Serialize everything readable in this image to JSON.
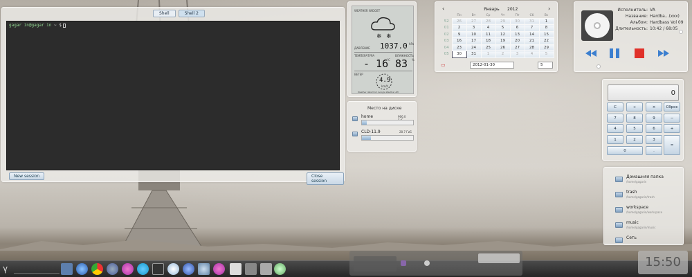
{
  "terminal": {
    "tabs": [
      "Shell",
      "Shell 2"
    ],
    "prompt_user": "gagar in@gagar in",
    "prompt_rest": " ~ $",
    "new_session": "New session",
    "close_session": "Close session"
  },
  "weather": {
    "title": "WEATHER WIDGET",
    "pressure_label": "ДАВЛЕНИЕ",
    "pressure_value": "1037.0",
    "pressure_unit": "hPa",
    "temperature_label": "ТЕМПЕРАТУРА",
    "temperature_value": "- 16",
    "temperature_unit": "°C",
    "humidity_label": "ВЛАЖНОСТЬ",
    "humidity_value": "83",
    "humidity_unit": "%",
    "wind_label": "ВЕТЕР",
    "wind_value": "4.9",
    "wind_unit": "km/h",
    "footer": "Weather data from Google Weather API"
  },
  "disk": {
    "title": "Место на диске",
    "items": [
      {
        "name": "home",
        "size": "966.0 ГиБ",
        "fraction": 0.1
      },
      {
        "name": "CLD-11.9",
        "size": "28.7 ГиБ",
        "fraction": 0.18
      }
    ]
  },
  "calendar": {
    "month": "Январь",
    "year": "2012",
    "prev": "‹",
    "next": "›",
    "weekdays": [
      "Пн",
      "Вт",
      "Ср",
      "Чт",
      "Пт",
      "Сб",
      "Вс"
    ],
    "weeks": [
      {
        "wk": "52",
        "days": [
          "26",
          "27",
          "28",
          "29",
          "30",
          "31",
          "1"
        ],
        "dim": [
          true,
          true,
          true,
          true,
          true,
          true,
          false
        ]
      },
      {
        "wk": "01",
        "days": [
          "2",
          "3",
          "4",
          "5",
          "6",
          "7",
          "8"
        ],
        "dim": [
          false,
          false,
          false,
          false,
          false,
          false,
          false
        ]
      },
      {
        "wk": "02",
        "days": [
          "9",
          "10",
          "11",
          "12",
          "13",
          "14",
          "15"
        ],
        "dim": [
          false,
          false,
          false,
          false,
          false,
          false,
          false
        ]
      },
      {
        "wk": "03",
        "days": [
          "16",
          "17",
          "18",
          "19",
          "20",
          "21",
          "22"
        ],
        "dim": [
          false,
          false,
          false,
          false,
          false,
          false,
          false
        ]
      },
      {
        "wk": "04",
        "days": [
          "23",
          "24",
          "25",
          "26",
          "27",
          "28",
          "29"
        ],
        "dim": [
          false,
          false,
          false,
          false,
          false,
          false,
          false
        ]
      },
      {
        "wk": "05",
        "days": [
          "30",
          "31",
          "1",
          "2",
          "3",
          "4",
          "5"
        ],
        "dim": [
          false,
          false,
          true,
          true,
          true,
          true,
          true
        ]
      }
    ],
    "selected_day": "30",
    "date_value": "2012-01-30",
    "week_value": "5"
  },
  "media": {
    "artist_label": "Исполнитель:",
    "artist": "VA",
    "title_label": "Название:",
    "title": "Hardba...(xxx)",
    "album_label": "Альбом:",
    "album": "Hardbass Vol 09",
    "duration_label": "Длительность:",
    "duration": "10:42 / 68:05",
    "progress": 0.16,
    "volume": 0.9
  },
  "calculator": {
    "display": "0",
    "keys": [
      [
        "C",
        "÷",
        "×",
        "Сброс"
      ],
      [
        "7",
        "8",
        "9",
        "−"
      ],
      [
        "4",
        "5",
        "6",
        "+"
      ],
      [
        "1",
        "2",
        "3",
        "="
      ],
      [
        "0",
        ".",
        "",
        ""
      ]
    ]
  },
  "places": [
    {
      "name": "Домашняя папка",
      "path": "/home/gagarin"
    },
    {
      "name": "trash",
      "path": "/home/gagarin/trash"
    },
    {
      "name": "workspace",
      "path": "/home/gagarin/workspace"
    },
    {
      "name": "music",
      "path": "/home/gagarin/music"
    },
    {
      "name": "Сеть",
      "path": ""
    }
  ],
  "clock": "15:50",
  "colors": {
    "terminal_bg": "#2c2c2c",
    "accent_blue": "#3c7fcf",
    "stop_red": "#e0312a"
  }
}
